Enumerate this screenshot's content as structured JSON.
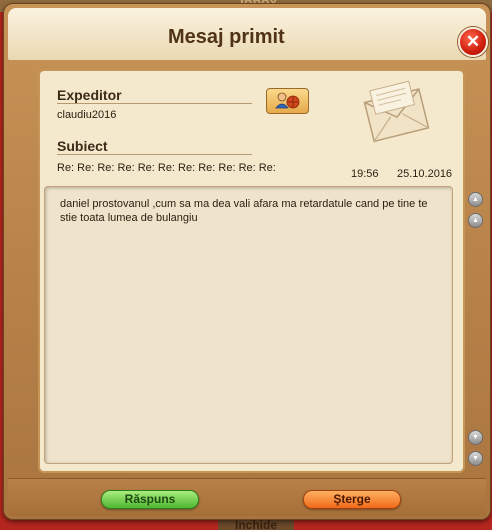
{
  "background": {
    "top_tab_label": "Inbox",
    "bottom_tab_label": "Inchide"
  },
  "dialog": {
    "title": "Mesaj primit",
    "close_symbol": "✕",
    "sender_label": "Expeditor",
    "sender_value": "claudiu2016",
    "subject_label": "Subiect",
    "subject_value": "Re: Re: Re: Re: Re: Re: Re: Re: Re: Re: Re:",
    "time": "19:56",
    "date": "25.10.2016",
    "message_body": "daniel prostovanul ,cum sa ma dea vali afara ma retardatule cand pe tine te stie toata lumea de bulangiu",
    "reply_label": "Răspuns",
    "delete_label": "Şterge"
  },
  "icons": {
    "close": "close-icon",
    "player_profile": "player-profile-icon",
    "envelope": "envelope-icon",
    "scroll_up": "scroll-up-icon",
    "scroll_down": "scroll-down-icon"
  },
  "colors": {
    "accent_green": "#4fb732",
    "accent_orange": "#f06a1a",
    "close_red": "#cf1c0c",
    "panel_bg": "#f4e8cd",
    "frame_brown": "#a9743f"
  }
}
